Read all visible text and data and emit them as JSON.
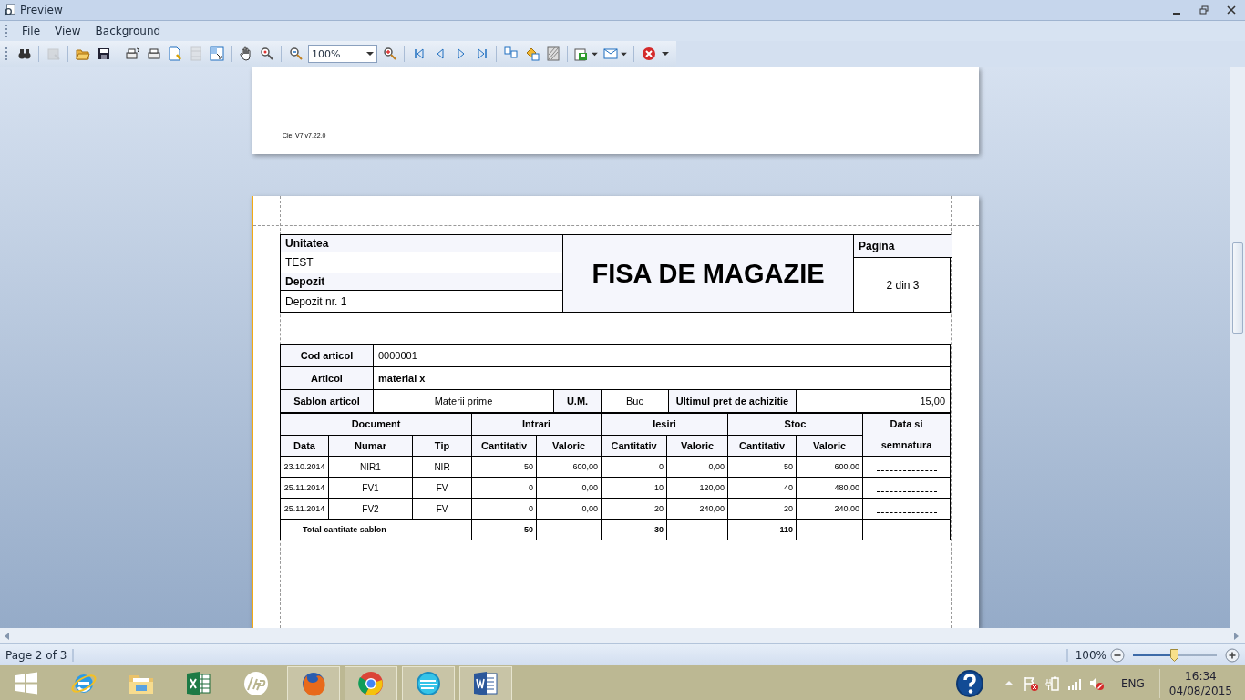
{
  "window": {
    "title": "Preview"
  },
  "menu": [
    "File",
    "View",
    "Background"
  ],
  "toolbar": [
    {
      "kind": "find",
      "disabled": false
    },
    {
      "kind": "separator"
    },
    {
      "kind": "parameters",
      "disabled": true
    },
    {
      "kind": "separator"
    },
    {
      "kind": "open",
      "disabled": false
    },
    {
      "kind": "save",
      "disabled": false
    },
    {
      "kind": "separator"
    },
    {
      "kind": "print_dialog",
      "disabled": false
    },
    {
      "kind": "quick_print",
      "disabled": false
    },
    {
      "kind": "page_setup",
      "disabled": false
    },
    {
      "kind": "header_footer",
      "disabled": true
    },
    {
      "kind": "scale",
      "disabled": false
    },
    {
      "kind": "separator"
    },
    {
      "kind": "hand",
      "disabled": false
    },
    {
      "kind": "magnifier",
      "disabled": false
    },
    {
      "kind": "separator"
    },
    {
      "kind": "zoom_out",
      "disabled": false
    },
    {
      "kind": "zoom_field",
      "value": "100%"
    },
    {
      "kind": "zoom_in",
      "disabled": false
    },
    {
      "kind": "separator"
    },
    {
      "kind": "first",
      "disabled": false
    },
    {
      "kind": "previous",
      "disabled": false
    },
    {
      "kind": "next",
      "disabled": false
    },
    {
      "kind": "last",
      "disabled": false
    },
    {
      "kind": "separator"
    },
    {
      "kind": "multiple",
      "disabled": false
    },
    {
      "kind": "fill",
      "disabled": false
    },
    {
      "kind": "watermark",
      "disabled": false
    },
    {
      "kind": "separator"
    },
    {
      "kind": "export",
      "disabled": false
    },
    {
      "kind": "send",
      "disabled": false
    },
    {
      "kind": "separator"
    },
    {
      "kind": "close",
      "disabled": false
    },
    {
      "kind": "more"
    }
  ],
  "previous_page": {
    "footer": "Ciel V7 v7.22.0"
  },
  "page": {
    "header": {
      "unit_label": "Unitatea",
      "unit": "TEST",
      "depot_label": "Depozit",
      "depot": "Depozit nr. 1",
      "title": "FISA DE MAGAZIE",
      "page_label": "Pagina",
      "page": "2 din 3"
    },
    "article": {
      "code_label": "Cod articol",
      "code": "0000001",
      "name_label": "Articol",
      "name": "material x",
      "template_label": "Sablon articol",
      "template": "Materii prime",
      "unit_label": "U.M.",
      "unit": "Buc",
      "price_label": "Ultimul pret de achizitie",
      "price": "15,00"
    },
    "column_groups": [
      "Document",
      "Intrari",
      "Iesiri",
      "Stoc"
    ],
    "signature_header": "Data si semnatura",
    "columns": [
      "Data",
      "Numar",
      "Tip",
      "Cantitativ",
      "Valoric",
      "Cantitativ",
      "Valoric",
      "Cantitativ",
      "Valoric"
    ],
    "rows": [
      {
        "cells": [
          "23.10.2014",
          "NIR1",
          "NIR",
          "50",
          "600,00",
          "0",
          "0,00",
          "50",
          "600,00"
        ]
      },
      {
        "cells": [
          "25.11.2014",
          "FV1",
          "FV",
          "0",
          "0,00",
          "10",
          "120,00",
          "40",
          "480,00"
        ]
      },
      {
        "cells": [
          "25.11.2014",
          "FV2",
          "FV",
          "0",
          "0,00",
          "20",
          "240,00",
          "20",
          "240,00"
        ]
      }
    ],
    "total": {
      "label": "Total cantitate sablon",
      "in_qty": "50",
      "out_qty": "30",
      "stock_qty": "110"
    }
  },
  "status_bar": {
    "page": "Page 2 of 3",
    "zoom": "100%",
    "zoom_slider": {
      "level": 0.49
    }
  },
  "taskbar": {
    "apps": [
      {
        "kind": "start",
        "running": false
      },
      {
        "kind": "browser_e",
        "running": false
      },
      {
        "kind": "folder",
        "running": false
      },
      {
        "kind": "spreadsheet",
        "running": false
      },
      {
        "kind": "printer_brand",
        "running": false
      },
      {
        "kind": "fox_browser",
        "running": true
      },
      {
        "kind": "round_browser",
        "running": true
      },
      {
        "kind": "ciel",
        "running": true
      },
      {
        "kind": "document",
        "running": true
      }
    ],
    "language": "ENG",
    "time": "16:34",
    "date": "04/08/2015"
  }
}
